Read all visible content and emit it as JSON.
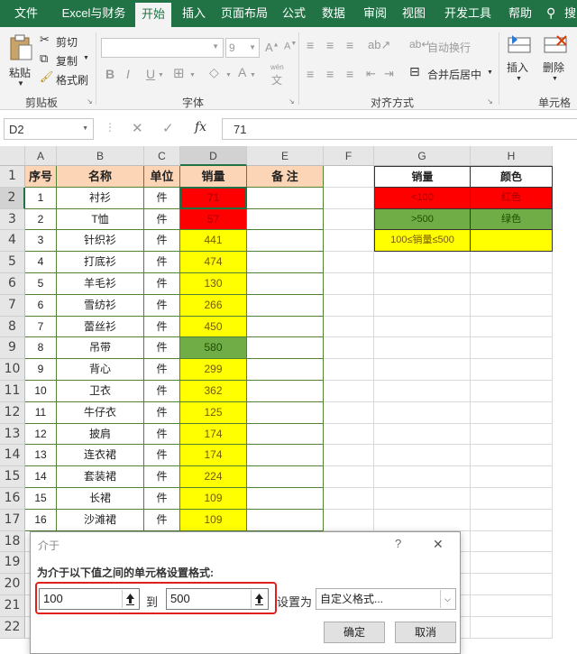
{
  "menu": {
    "tabs": [
      "文件",
      "Excel与财务",
      "开始",
      "插入",
      "页面布局",
      "公式",
      "数据",
      "审阅",
      "视图",
      "开发工具",
      "帮助"
    ]
  },
  "ribbon": {
    "paste": "粘贴",
    "cut": "剪切",
    "copy": "复制",
    "format_painter": "格式刷",
    "clipboard_group": "剪贴板",
    "font_size": "9",
    "bold": "B",
    "italic": "I",
    "underline": "U",
    "font_group": "字体",
    "wen": "wén",
    "wrap_text": "自动换行",
    "merge_center": "合并后居中",
    "align_group": "对齐方式",
    "insert": "插入",
    "delete": "删除",
    "cells_group": "单元格",
    "search_partial": "搜"
  },
  "formula_bar": {
    "name_box": "D2",
    "fx": "fx",
    "value": "71"
  },
  "sheet": {
    "columns": [
      "A",
      "B",
      "C",
      "D",
      "E",
      "F",
      "G",
      "H"
    ],
    "rows": [
      "1",
      "2",
      "3",
      "4",
      "5",
      "6",
      "7",
      "8",
      "9",
      "10",
      "11",
      "12",
      "13",
      "14",
      "15",
      "16",
      "17",
      "18",
      "19",
      "20",
      "21",
      "22"
    ],
    "headers": [
      "序号",
      "名称",
      "单位",
      "销量",
      "备  注"
    ],
    "data": [
      [
        "1",
        "衬衫",
        "件",
        "71"
      ],
      [
        "2",
        "T恤",
        "件",
        "57"
      ],
      [
        "3",
        "针织衫",
        "件",
        "441"
      ],
      [
        "4",
        "打底衫",
        "件",
        "474"
      ],
      [
        "5",
        "羊毛衫",
        "件",
        "130"
      ],
      [
        "6",
        "雪纺衫",
        "件",
        "266"
      ],
      [
        "7",
        "蕾丝衫",
        "件",
        "450"
      ],
      [
        "8",
        "吊带",
        "件",
        "580"
      ],
      [
        "9",
        "背心",
        "件",
        "299"
      ],
      [
        "10",
        "卫衣",
        "件",
        "362"
      ],
      [
        "11",
        "牛仔衣",
        "件",
        "125"
      ],
      [
        "12",
        "披肩",
        "件",
        "174"
      ],
      [
        "13",
        "连衣裙",
        "件",
        "174"
      ],
      [
        "14",
        "套装裙",
        "件",
        "224"
      ],
      [
        "15",
        "长裙",
        "件",
        "109"
      ],
      [
        "16",
        "沙滩裙",
        "件",
        "109"
      ]
    ],
    "legend": {
      "headers": [
        "销量",
        "颜色"
      ],
      "rows": [
        [
          "<100",
          "红色"
        ],
        [
          ">500",
          "绿色"
        ],
        [
          "100≤销量≤500",
          ""
        ]
      ]
    }
  },
  "dialog": {
    "title": "介于",
    "help": "?",
    "close": "✕",
    "prompt": "为介于以下值之间的单元格设置格式:",
    "from_value": "100",
    "to_label": "到",
    "to_value": "500",
    "set_as_label": "设置为",
    "format_option": "自定义格式...",
    "ok": "确定",
    "cancel": "取消"
  },
  "colors": {
    "excel_green": "#217346",
    "red": "#ff0000",
    "yellow": "#ffff00",
    "green": "#70ad47",
    "header_fill": "#fbd5b5",
    "highlight": "#e0201c"
  }
}
